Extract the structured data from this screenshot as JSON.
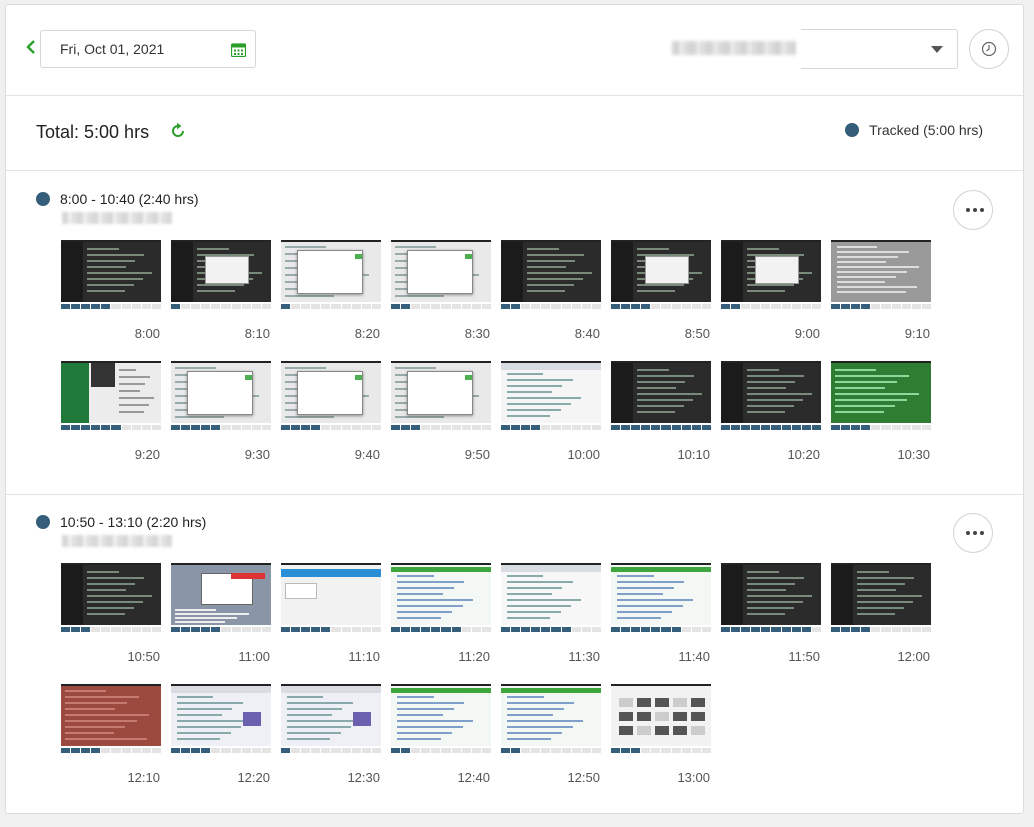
{
  "header": {
    "date": "Fri, Oct 01, 2021",
    "user_name": "",
    "icons": {
      "back": "chevron-left-icon",
      "calendar": "calendar-icon",
      "dropdown": "caret-down-icon",
      "clock": "clock-icon"
    }
  },
  "summary": {
    "total_label": "Total: 5:00 hrs",
    "legend_label": "Tracked (5:00 hrs)",
    "tracked_color": "#345e79",
    "accent_color": "#2aa02a"
  },
  "blocks": [
    {
      "range": "8:00 - 10:40 (2:40 hrs)",
      "thumbs": [
        {
          "time": "8:00",
          "active": 5,
          "theme": "dark"
        },
        {
          "time": "8:10",
          "active": 1,
          "theme": "dark-dialog"
        },
        {
          "time": "8:20",
          "active": 1,
          "theme": "light-dialog"
        },
        {
          "time": "8:30",
          "active": 2,
          "theme": "light-dialog"
        },
        {
          "time": "8:40",
          "active": 2,
          "theme": "dark"
        },
        {
          "time": "8:50",
          "active": 4,
          "theme": "dark-dialog"
        },
        {
          "time": "9:00",
          "active": 2,
          "theme": "dark-dialog"
        },
        {
          "time": "9:10",
          "active": 4,
          "theme": "gray-list"
        },
        {
          "time": "9:20",
          "active": 6,
          "theme": "green-window"
        },
        {
          "time": "9:30",
          "active": 5,
          "theme": "light-dialog"
        },
        {
          "time": "9:40",
          "active": 4,
          "theme": "light-dialog"
        },
        {
          "time": "9:50",
          "active": 3,
          "theme": "light-dialog"
        },
        {
          "time": "10:00",
          "active": 4,
          "theme": "light"
        },
        {
          "time": "10:10",
          "active": 10,
          "theme": "dark"
        },
        {
          "time": "10:20",
          "active": 10,
          "theme": "dark"
        },
        {
          "time": "10:30",
          "active": 4,
          "theme": "green"
        }
      ]
    },
    {
      "range": "10:50 - 13:10 (2:20 hrs)",
      "thumbs": [
        {
          "time": "10:50",
          "active": 3,
          "theme": "dark"
        },
        {
          "time": "11:00",
          "active": 5,
          "theme": "red-window"
        },
        {
          "time": "11:10",
          "active": 5,
          "theme": "blue-web"
        },
        {
          "time": "11:20",
          "active": 7,
          "theme": "green-web"
        },
        {
          "time": "11:30",
          "active": 7,
          "theme": "light-web"
        },
        {
          "time": "11:40",
          "active": 7,
          "theme": "green-web"
        },
        {
          "time": "11:50",
          "active": 9,
          "theme": "dark"
        },
        {
          "time": "12:00",
          "active": 4,
          "theme": "dark"
        },
        {
          "time": "12:10",
          "active": 4,
          "theme": "red"
        },
        {
          "time": "12:20",
          "active": 4,
          "theme": "purple-web"
        },
        {
          "time": "12:30",
          "active": 1,
          "theme": "purple-web"
        },
        {
          "time": "12:40",
          "active": 2,
          "theme": "green-web"
        },
        {
          "time": "12:50",
          "active": 2,
          "theme": "green-web"
        },
        {
          "time": "13:00",
          "active": 3,
          "theme": "tiles"
        }
      ]
    }
  ]
}
